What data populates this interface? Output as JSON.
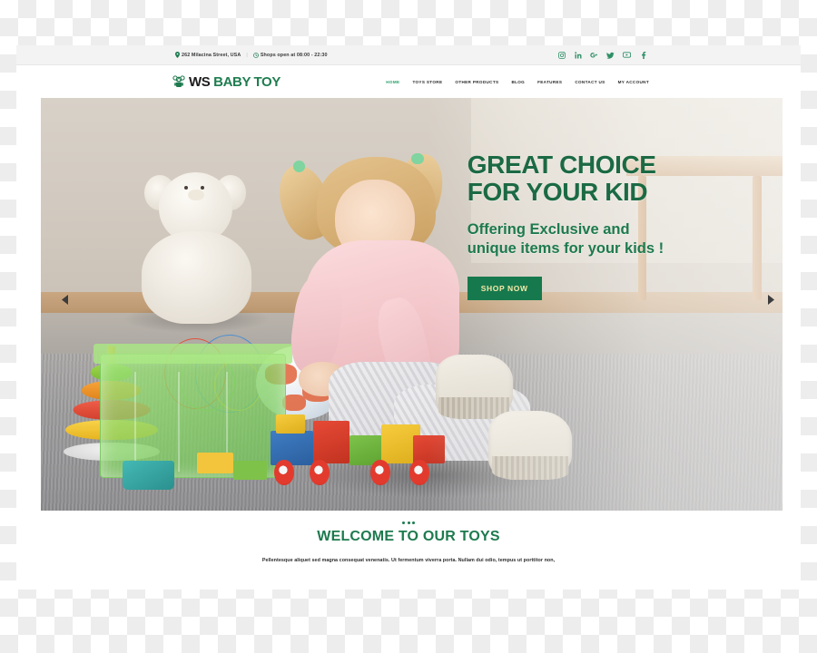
{
  "topbar": {
    "address": "262 Milacina Street, USA",
    "separator": "|",
    "hours": "Shops open at 08:00 - 22:30",
    "location_icon": "map-pin-icon",
    "clock_icon": "clock-icon",
    "socials": [
      {
        "name": "instagram-icon",
        "label": "Instagram"
      },
      {
        "name": "linkedin-icon",
        "label": "in"
      },
      {
        "name": "googleplus-icon",
        "label": "G+"
      },
      {
        "name": "twitter-icon",
        "label": "Twitter"
      },
      {
        "name": "youtube-icon",
        "label": "YouTube"
      },
      {
        "name": "facebook-icon",
        "label": "f"
      }
    ]
  },
  "header": {
    "logo_icon": "teddy-bear-icon",
    "logo_primary": "WS",
    "logo_secondary": "BABY TOY",
    "nav": [
      {
        "label": "HOME",
        "active": true
      },
      {
        "label": "TOYS STORE",
        "active": false
      },
      {
        "label": "OTHER PRODUCTS",
        "active": false
      },
      {
        "label": "BLOG",
        "active": false
      },
      {
        "label": "FEATURES",
        "active": false
      },
      {
        "label": "CONTACT US",
        "active": false
      },
      {
        "label": "MY ACCOUNT",
        "active": false
      }
    ]
  },
  "hero": {
    "heading_line1": "GREAT CHOICE",
    "heading_line2": "FOR YOUR KID",
    "sub_line1": "Offering Exclusive and",
    "sub_line2": "unique items for your kids !",
    "button_label": "SHOP NOW",
    "prev_icon": "chevron-left-icon",
    "next_icon": "chevron-right-icon",
    "alt": "Toddler girl playing with colorful building blocks and toys on a carpet in a nursery"
  },
  "welcome": {
    "title": "WELCOME TO OUR TOYS",
    "paragraph": "Pellentesque aliquet sed magna consequat venenatis. Ut fermentum viverra porta. Nullam dui odio, tempus ut porttitor non,"
  },
  "colors": {
    "brand_green": "#1d7a4e",
    "heading_green": "#1b6a44",
    "accent_green": "#23a06a",
    "button_bg": "#16794d",
    "button_text": "#f6e8a8",
    "topbar_bg": "#f3f3f3",
    "page_bg": "#ffffff"
  }
}
